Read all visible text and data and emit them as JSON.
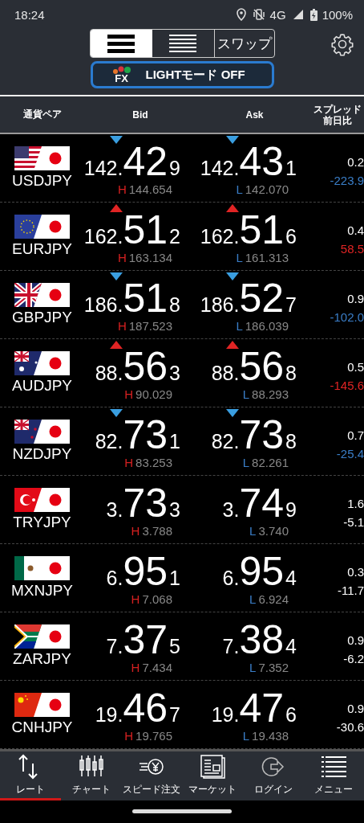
{
  "status_bar": {
    "time": "18:24",
    "network": "4G",
    "battery": "100%"
  },
  "view_switch": [
    {
      "kind": "wide",
      "selected": true
    },
    {
      "kind": "compact",
      "selected": false
    },
    {
      "kind": "text",
      "label": "スワップ",
      "selected": false
    }
  ],
  "light_mode_button": {
    "badge": "FX",
    "label": "LIGHTモード OFF"
  },
  "table": {
    "columns": [
      "通貨ペア",
      "Bid",
      "Ask",
      "スプレッド前日比"
    ],
    "rows": [
      {
        "kind": "us",
        "pair": "USDJPY",
        "up": false,
        "down": true,
        "bid": [
          "142.",
          "42",
          "9"
        ],
        "high_mark": "H",
        "high": "144.654",
        "ask": [
          "142.",
          "43",
          "1"
        ],
        "low_mark": "L",
        "low": "142.070",
        "spread": "0.2",
        "change": "-223.9"
      },
      {
        "kind": "eu",
        "pair": "EURJPY",
        "up": true,
        "down": false,
        "bid": [
          "162.",
          "51",
          "2"
        ],
        "high_mark": "H",
        "high": "163.134",
        "ask": [
          "162.",
          "51",
          "6"
        ],
        "low_mark": "L",
        "low": "161.313",
        "spread": "0.4",
        "change": "58.5"
      },
      {
        "kind": "gb",
        "pair": "GBPJPY",
        "up": false,
        "down": true,
        "bid": [
          "186.",
          "51",
          "8"
        ],
        "high_mark": "H",
        "high": "187.523",
        "ask": [
          "186.",
          "52",
          "7"
        ],
        "low_mark": "L",
        "low": "186.039",
        "spread": "0.9",
        "change": "-102.0"
      },
      {
        "kind": "au",
        "pair": "AUDJPY",
        "up": true,
        "down": false,
        "bid": [
          "88.",
          "56",
          "3"
        ],
        "high_mark": "H",
        "high": "90.029",
        "ask": [
          "88.",
          "56",
          "8"
        ],
        "low_mark": "L",
        "low": "88.293",
        "spread": "0.5",
        "change": "-145.6"
      },
      {
        "kind": "nz",
        "pair": "NZDJPY",
        "up": false,
        "down": true,
        "bid": [
          "82.",
          "73",
          "1"
        ],
        "high_mark": "H",
        "high": "83.253",
        "ask": [
          "82.",
          "73",
          "8"
        ],
        "low_mark": "L",
        "low": "82.261",
        "spread": "0.7",
        "change": "-25.4"
      },
      {
        "kind": "tr",
        "pair": "TRYJPY",
        "up": false,
        "down": false,
        "bid": [
          "3.",
          "73",
          "3"
        ],
        "high_mark": "H",
        "high": "3.788",
        "ask": [
          "3.",
          "74",
          "9"
        ],
        "low_mark": "L",
        "low": "3.740",
        "spread": "1.6",
        "change": "-5.1"
      },
      {
        "kind": "mx",
        "pair": "MXNJPY",
        "up": false,
        "down": false,
        "bid": [
          "6.",
          "95",
          "1"
        ],
        "high_mark": "H",
        "high": "7.068",
        "ask": [
          "6.",
          "95",
          "4"
        ],
        "low_mark": "L",
        "low": "6.924",
        "spread": "0.3",
        "change": "-11.7"
      },
      {
        "kind": "za",
        "pair": "ZARJPY",
        "up": false,
        "down": false,
        "bid": [
          "7.",
          "37",
          "5"
        ],
        "high_mark": "H",
        "high": "7.434",
        "ask": [
          "7.",
          "38",
          "4"
        ],
        "low_mark": "L",
        "low": "7.352",
        "spread": "0.9",
        "change": "-6.2"
      },
      {
        "kind": "cn",
        "pair": "CNHJPY",
        "up": false,
        "down": false,
        "bid": [
          "19.",
          "46",
          "7"
        ],
        "high_mark": "H",
        "high": "19.765",
        "ask": [
          "19.",
          "47",
          "6"
        ],
        "low_mark": "L",
        "low": "19.438",
        "spread": "0.9",
        "change": "-30.6"
      }
    ]
  },
  "bottom_nav": [
    {
      "kind": "rate",
      "label": "レート",
      "selected": true
    },
    {
      "kind": "chart",
      "label": "チャート",
      "selected": false
    },
    {
      "kind": "speed",
      "label": "スピード注文",
      "selected": false
    },
    {
      "kind": "market",
      "label": "マーケット",
      "selected": false
    },
    {
      "kind": "login",
      "label": "ログイン",
      "selected": false
    },
    {
      "kind": "menu",
      "label": "メニュー",
      "selected": false
    }
  ]
}
